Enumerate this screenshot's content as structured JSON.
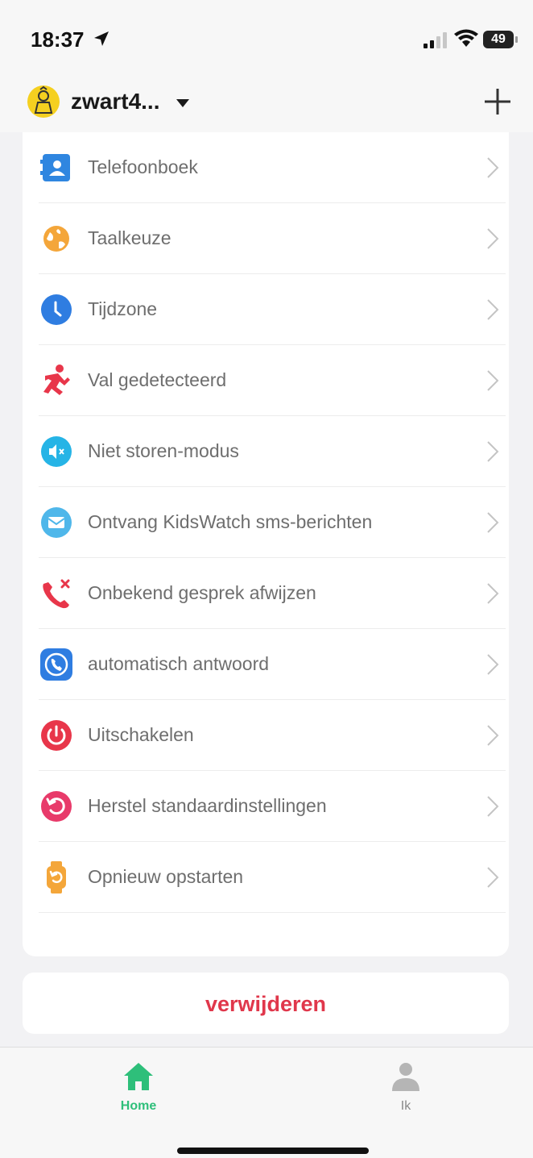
{
  "status_bar": {
    "time": "18:37",
    "battery": "49"
  },
  "header": {
    "device_name": "zwart4...",
    "avatar_icon": "child-avatar-icon",
    "add_icon": "plus-icon"
  },
  "settings": {
    "items": [
      {
        "label": "Telefoonboek",
        "icon": "contacts-icon",
        "color": "#2f86e0"
      },
      {
        "label": "Taalkeuze",
        "icon": "globe-icon",
        "color": "#f4a63a"
      },
      {
        "label": "Tijdzone",
        "icon": "clock-icon",
        "color": "#2f7de1"
      },
      {
        "label": "Val gedetecteerd",
        "icon": "fall-detected-icon",
        "color": "#e8364a"
      },
      {
        "label": "Niet storen-modus",
        "icon": "mute-icon",
        "color": "#26b4e6"
      },
      {
        "label": "Ontvang KidsWatch sms-berichten",
        "icon": "message-icon",
        "color": "#4fb7ea"
      },
      {
        "label": "Onbekend gesprek afwijzen",
        "icon": "reject-call-icon",
        "color": "#e8364a"
      },
      {
        "label": "automatisch antwoord",
        "icon": "auto-answer-icon",
        "color": "#2f7de1"
      },
      {
        "label": "Uitschakelen",
        "icon": "power-icon",
        "color": "#e8364a"
      },
      {
        "label": "Herstel standaardinstellingen",
        "icon": "reset-icon",
        "color": "#e83a6a"
      },
      {
        "label": "Opnieuw opstarten",
        "icon": "restart-watch-icon",
        "color": "#f4a63a"
      }
    ]
  },
  "delete_label": "verwijderen",
  "tabs": [
    {
      "label": "Home",
      "icon": "home-icon",
      "active": true
    },
    {
      "label": "Ik",
      "icon": "person-icon",
      "active": false
    }
  ],
  "colors": {
    "accent_green": "#2ebf7a",
    "delete_red": "#e0374b"
  }
}
